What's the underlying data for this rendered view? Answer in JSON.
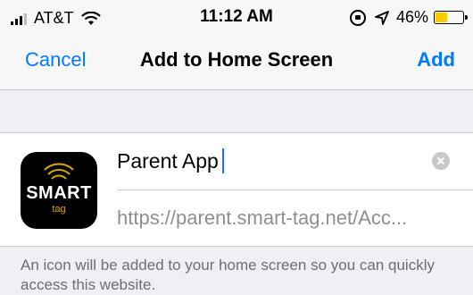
{
  "status_bar": {
    "carrier": "AT&T",
    "time": "11:12 AM",
    "battery_percent": "46%",
    "battery_level": 0.46,
    "battery_color": "#f7cd00",
    "icons": [
      "signal-icon",
      "wifi-icon",
      "rotation-lock-icon",
      "location-icon",
      "battery-icon"
    ]
  },
  "nav": {
    "cancel_label": "Cancel",
    "title": "Add to Home Screen",
    "add_label": "Add"
  },
  "form": {
    "app_name_value": "Parent App",
    "url": "https://parent.smart-tag.net/Acc...",
    "clear_icon": "clear-icon"
  },
  "app_icon": {
    "word": "SMART",
    "sub": "tag"
  },
  "footer": {
    "note": "An icon will be added to your home screen so you can quickly access this website."
  },
  "colors": {
    "accent": "#007aff",
    "caret": "#1a6cff"
  }
}
